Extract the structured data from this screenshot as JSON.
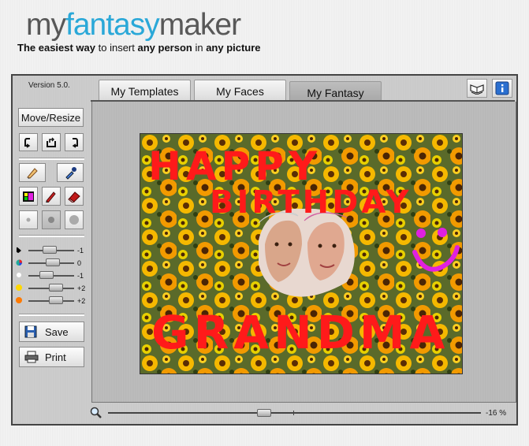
{
  "app": {
    "logo_part1": "my",
    "logo_part2": "fantasy",
    "logo_part3": "maker",
    "tagline": {
      "t1": "The ",
      "t2": "easiest way",
      "t3": " to insert ",
      "t4": "any person",
      "t5": " in ",
      "t6": "any picture"
    },
    "version": "Version 5.0.",
    "accent_color": "#2aa8d8"
  },
  "tabs": [
    {
      "label": "My Templates",
      "active": false
    },
    {
      "label": "My Faces",
      "active": false
    },
    {
      "label": "My Fantasy",
      "active": true
    }
  ],
  "toolbar": {
    "move_resize_label": "Move/Resize",
    "save_label": "Save",
    "print_label": "Print",
    "rotate_left_icon": "rotate-left-icon",
    "flip_icon": "flip-icon",
    "rotate_right_icon": "rotate-right-icon"
  },
  "adjustments": [
    {
      "name": "brightness",
      "color": "#000000",
      "value": "-1",
      "level": -1
    },
    {
      "name": "color",
      "color": "#e02020",
      "value": "0",
      "level": 0
    },
    {
      "name": "white",
      "color": "#ffffff",
      "value": "-1",
      "level": -1
    },
    {
      "name": "yellow",
      "color": "#ffd800",
      "value": "+2",
      "level": 2
    },
    {
      "name": "orange",
      "color": "#ff7a00",
      "value": "+2",
      "level": 2
    }
  ],
  "canvas": {
    "text_line1": "HAPPY",
    "text_line2": "BIRTHDAY",
    "text_line3": "GRANDMA",
    "paint_color": "#ff1a1a",
    "smiley_color": "#e020e0"
  },
  "zoom": {
    "value": "-16 %",
    "level": -16
  }
}
